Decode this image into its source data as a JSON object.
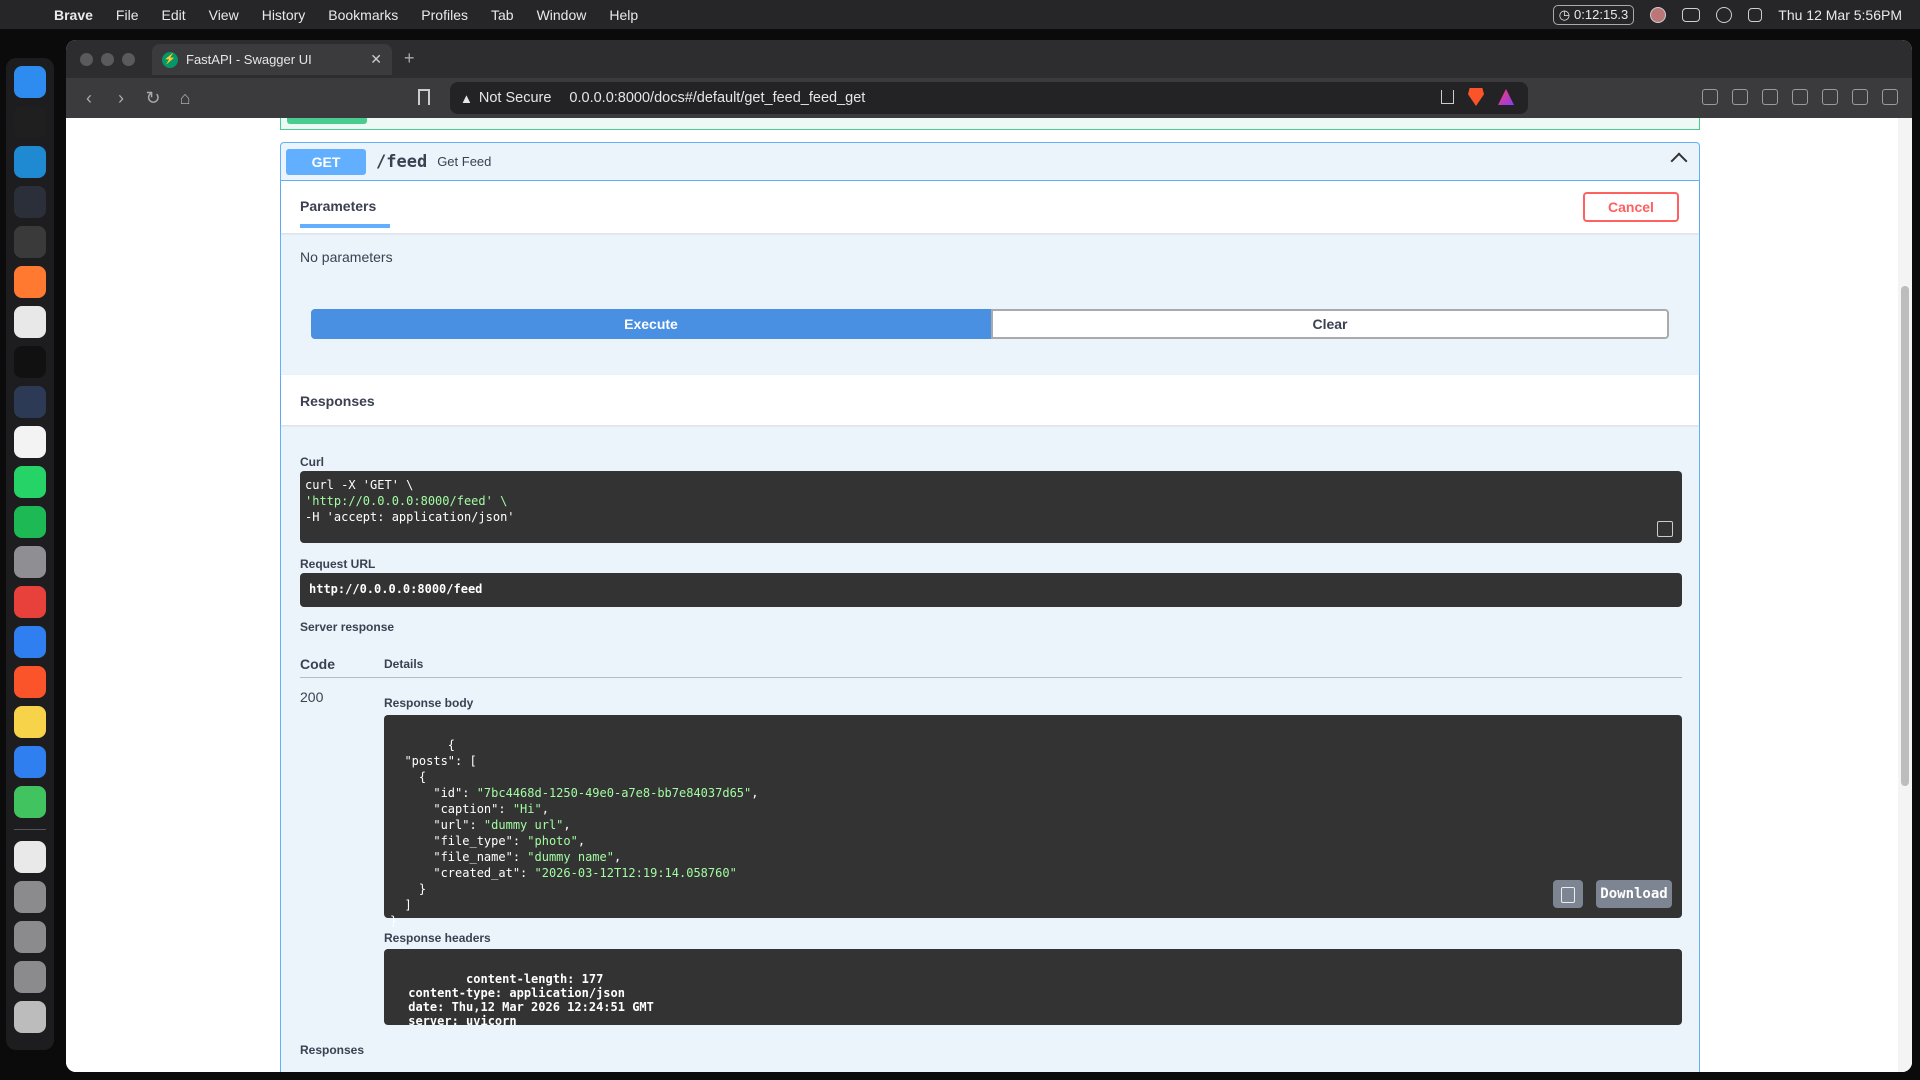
{
  "menubar": {
    "app": "Brave",
    "items": [
      "File",
      "Edit",
      "View",
      "History",
      "Bookmarks",
      "Profiles",
      "Tab",
      "Window",
      "Help"
    ],
    "timer": "0:12:15.3",
    "datetime": "Thu 12 Mar  5:56PM"
  },
  "dock": {
    "apps": [
      {
        "name": "finder",
        "color": "#2e8cf0"
      },
      {
        "name": "terminal",
        "color": "#1f1f1f"
      },
      {
        "name": "vscode",
        "color": "#1f8ad2"
      },
      {
        "name": "xcode-like",
        "color": "#2b2f3a"
      },
      {
        "name": "app-dark",
        "color": "#3a3a3a"
      },
      {
        "name": "pen-tool",
        "color": "#ff7a30"
      },
      {
        "name": "table-plus",
        "color": "#e8e8e8"
      },
      {
        "name": "chatgpt",
        "color": "#111111"
      },
      {
        "name": "ai-orb",
        "color": "#2c3a55"
      },
      {
        "name": "notion",
        "color": "#f3f3f3"
      },
      {
        "name": "whatsapp",
        "color": "#25d366"
      },
      {
        "name": "spotify",
        "color": "#1db954"
      },
      {
        "name": "settings",
        "color": "#8e8e93"
      },
      {
        "name": "calendar-red",
        "color": "#e8413b"
      },
      {
        "name": "safari",
        "color": "#2f7ff0"
      },
      {
        "name": "brave",
        "color": "#fb542b"
      },
      {
        "name": "notes",
        "color": "#f7d34a"
      },
      {
        "name": "tasks",
        "color": "#2f7ff0"
      },
      {
        "name": "numbers",
        "color": "#41c460"
      },
      {
        "name": "preview",
        "color": "#e9e9e9"
      },
      {
        "name": "folder",
        "color": "#8b8b8e"
      },
      {
        "name": "apps-folder",
        "color": "#8b8b8e"
      },
      {
        "name": "downloads-folder",
        "color": "#8b8b8e"
      },
      {
        "name": "trash",
        "color": "#bcbcbc"
      }
    ]
  },
  "browser": {
    "tab_title": "FastAPI - Swagger UI",
    "security_label": "Not Secure",
    "url": "0.0.0.0:8000/docs#/default/get_feed_feed_get"
  },
  "op": {
    "method": "GET",
    "path": "/feed",
    "summary": "Get Feed",
    "tab_parameters": "Parameters",
    "cancel": "Cancel",
    "no_params": "No parameters",
    "execute": "Execute",
    "clear": "Clear",
    "responses_title": "Responses",
    "curl_label": "Curl",
    "curl_lines": [
      "curl -X 'GET' \\",
      "  'http://0.0.0.0:8000/feed' \\",
      "  -H 'accept: application/json'"
    ],
    "request_url_label": "Request URL",
    "request_url": "http://0.0.0.0:8000/feed",
    "server_response_label": "Server response",
    "code_header": "Code",
    "details_header": "Details",
    "status_code": "200",
    "response_body_label": "Response body",
    "response_body": "{\n  \"posts\": [\n    {\n      \"id\": \"7bc4468d-1250-49e0-a7e8-bb7e84037d65\",\n      \"caption\": \"Hi\",\n      \"url\": \"dummy url\",\n      \"file_type\": \"photo\",\n      \"file_name\": \"dummy name\",\n      \"created_at\": \"2026-03-12T12:19:14.058760\"\n    }\n  ]\n}",
    "download": "Download",
    "response_headers_label": "Response headers",
    "response_headers": " content-length: 177 \n content-type: application/json \n date: Thu,12 Mar 2026 12:24:51 GMT \n server: uvicorn ",
    "responses_footer": "Responses"
  }
}
